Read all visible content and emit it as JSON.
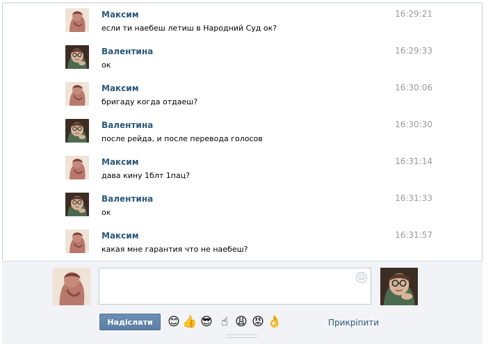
{
  "messages": [
    {
      "author": "Максим",
      "text": "если ти наебеш летиш в Народний Суд ок?",
      "time": "16:29:21",
      "avatar": "maksim-avatar"
    },
    {
      "author": "Валентина",
      "text": "ок",
      "time": "16:29:33",
      "avatar": "valentina-avatar"
    },
    {
      "author": "Максим",
      "text": "бригаду когда отдаеш?",
      "time": "16:30:06",
      "avatar": "maksim-avatar"
    },
    {
      "author": "Валентина",
      "text": "после рейда, и после перевода голосов",
      "time": "16:30:30",
      "avatar": "valentina-avatar"
    },
    {
      "author": "Максим",
      "text": "дава кину 1блт 1пац?",
      "time": "16:31:14",
      "avatar": "maksim-avatar"
    },
    {
      "author": "Валентина",
      "text": "ок",
      "time": "16:31:33",
      "avatar": "valentina-avatar"
    },
    {
      "author": "Максим",
      "text": "какая мне гарантия что не наебеш?",
      "time": "16:31:57",
      "avatar": "maksim-avatar"
    }
  ],
  "composer": {
    "message_value": "",
    "send_label": "Надіслати",
    "attach_label": "Прикріпити",
    "emoji": [
      {
        "char": "😊",
        "name": "smile-emoji-icon"
      },
      {
        "char": "👍",
        "name": "thumbs-up-emoji-icon"
      },
      {
        "char": "😎",
        "name": "sunglasses-emoji-icon"
      },
      {
        "char": "☝",
        "name": "finger-up-emoji-icon"
      },
      {
        "char": "😩",
        "name": "weary-emoji-icon"
      },
      {
        "char": "😡",
        "name": "angry-emoji-icon"
      },
      {
        "char": "👌",
        "name": "ok-hand-emoji-icon"
      }
    ]
  },
  "colors": {
    "author": "#2b587a",
    "time": "#999999",
    "send_button": "#5b7fa6",
    "composer_bg": "#f2f3f6"
  }
}
